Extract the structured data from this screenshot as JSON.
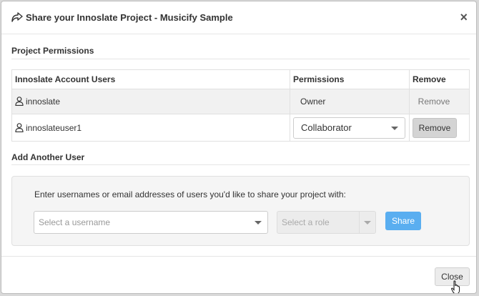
{
  "dialog": {
    "title": "Share your Innoslate Project - Musicify Sample",
    "close_symbol": "×"
  },
  "permissions_section": {
    "title": "Project Permissions",
    "columns": [
      "Innoslate Account Users",
      "Permissions",
      "Remove"
    ],
    "rows": [
      {
        "user": "innoslate",
        "permission": "Owner",
        "remove_label": "Remove"
      },
      {
        "user": "innoslateuser1",
        "permission": "Collaborator",
        "remove_label": "Remove"
      }
    ]
  },
  "add_section": {
    "title": "Add Another User",
    "prompt": "Enter usernames or email addresses of users you'd like to share your project with:",
    "username_placeholder": "Select a username",
    "role_placeholder": "Select a role",
    "share_label": "Share"
  },
  "footer": {
    "close_label": "Close"
  },
  "icons": {
    "header": "share-icon",
    "user": "user-icon",
    "dropdown": "chevron-down-icon"
  },
  "colors": {
    "accent": "#5aaef0",
    "remove_button": "#d4d4d4"
  }
}
